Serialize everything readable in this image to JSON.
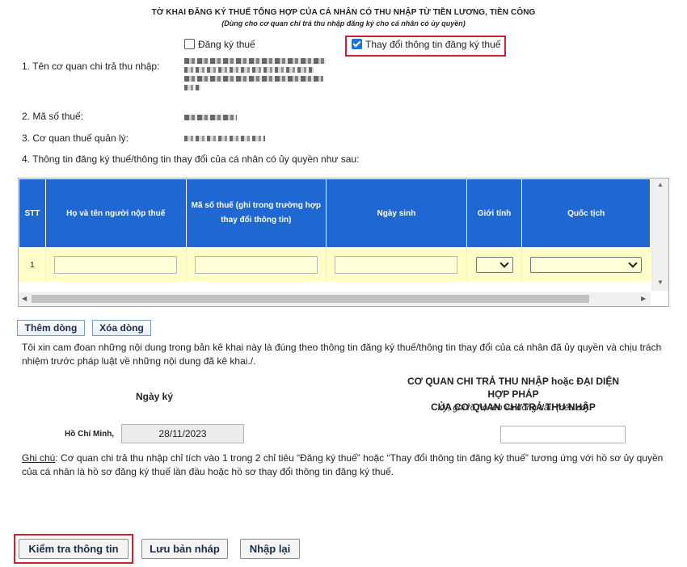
{
  "header": {
    "title": "TỜ KHAI ĐĂNG KÝ THUẾ TỔNG HỢP CỦA CÁ NHÂN CÓ THU NHẬP TỪ TIỀN LƯƠNG, TIỀN CÔNG",
    "subtitle": "(Dùng cho cơ quan chi trả thu nhập đăng ký cho cá nhân có ủy quyền)"
  },
  "options": {
    "register_label": "Đăng ký thuế",
    "register_checked": false,
    "change_label": "Thay đổi thông tin đăng ký thuế",
    "change_checked": true
  },
  "fields": {
    "payer_name_label": "1. Tên cơ quan chi trả thu nhập:",
    "tax_code_label": "2. Mã số thuế:",
    "tax_office_label": "3. Cơ quan thuế quản lý:",
    "section4_label": "4. Thông tin đăng ký thuế/thông tin thay đổi của cá nhân có ủy quyền như sau:"
  },
  "grid": {
    "columns": [
      "STT",
      "Họ và tên người nộp thuế",
      "Mã số thuế (ghi trong trường hợp thay đổi thông tin)",
      "Ngày sinh",
      "Giới tính",
      "Quốc tịch"
    ],
    "rows": [
      {
        "stt": "1"
      }
    ]
  },
  "grid_buttons": {
    "add_row": "Thêm dòng",
    "delete_row": "Xóa dòng"
  },
  "declaration": "Tôi xin cam đoan những nội dung trong bản kê khai này là đúng theo thông tin đăng ký thuế/thông tin thay đổi của cá nhân đã ủy quyền và chịu trách nhiệm trước pháp luật về những nội dung đã kê khai./.",
  "signature": {
    "date_heading": "Ngày ký",
    "location": "Hồ Chí Minh,",
    "date_value": "28/11/2023",
    "org_heading_line1": "CƠ QUAN CHI TRẢ THU NHẬP hoặc ĐẠI DIỆN HỢP PHÁP",
    "org_heading_line2": "CỦA CƠ QUAN CHI TRẢ THU NHẬP",
    "org_note": "Ký, ghi rõ họ tên và đóng dấu (nếu có)"
  },
  "note": {
    "label": "Ghi chú",
    "text": ": Cơ quan chi trả thu nhập chỉ tích vào 1 trong 2 chỉ tiêu “Đăng ký thuế” hoặc “Thay đổi thông tin đăng ký thuế” tương ứng với hồ sơ ủy quyền của cá nhân là hồ sơ đăng ký thuế lần đầu hoặc hồ sơ thay đổi thông tin đăng ký thuế."
  },
  "actions": {
    "check": "Kiểm tra thông tin",
    "save_draft": "Lưu bản nháp",
    "reset": "Nhập lại"
  },
  "colors": {
    "grid_header": "#1f67d2",
    "grid_row": "#ffffc8",
    "highlight_border": "#d02030"
  }
}
